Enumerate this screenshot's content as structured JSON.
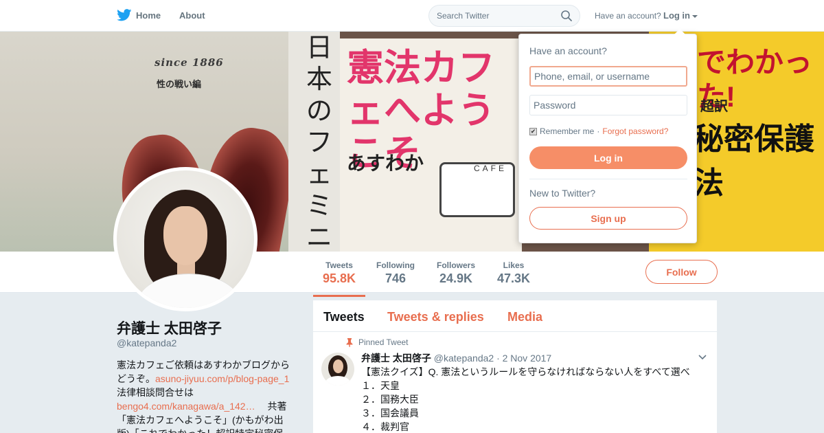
{
  "topnav": {
    "home_label": "Home",
    "about_label": "About",
    "search_placeholder": "Search Twitter",
    "have_account_text": "Have an account?",
    "login_label": "Log in",
    "brand_color": "#1da1f2"
  },
  "banner": {
    "left_book_since": "since 1886",
    "left_book_subtitle": "性の戦い編",
    "vertical_title": "日本のフェミニズ",
    "middle_title": "憲法カフェへようこそ",
    "middle_author": "あすわか",
    "cup_text": "CAFE",
    "right_title": "でわかった!",
    "right_sub": "超訳",
    "right_main": "秘密保護法"
  },
  "profile": {
    "name": "弁護士 太田啓子",
    "handle": "@katepanda2",
    "bio_text_1": "憲法カフェご依頼はあすわかブログからどうぞ。",
    "bio_link_1": "asuno-jiyuu.com/p/blog-page_1",
    "bio_text_2": " 　法律相談問合せは",
    "bio_link_2": "bengo4.com/kanagawa/a_142…",
    "bio_text_3": " 　共著「憲法カフェへようこそ」(かもがわ出版)「これでわかった！超訳特定秘密保"
  },
  "stats": [
    {
      "label": "Tweets",
      "value": "95.8K",
      "active": true
    },
    {
      "label": "Following",
      "value": "746"
    },
    {
      "label": "Followers",
      "value": "24.9K"
    },
    {
      "label": "Likes",
      "value": "47.3K"
    }
  ],
  "follow_button_label": "Follow",
  "timeline": {
    "tabs": [
      "Tweets",
      "Tweets & replies",
      "Media"
    ],
    "pinned_label": "Pinned Tweet",
    "tweet": {
      "name": "弁護士 太田啓子",
      "handle": "@katepanda2",
      "date": "· 2 Nov 2017",
      "lines": [
        "【憲法クイズ】Q. 憲法というルールを守らなければならない人をすべて選べ",
        "１．天皇",
        "２．国務大臣",
        "３．国会議員",
        "４．裁判官"
      ]
    }
  },
  "login_dropdown": {
    "title": "Have an account?",
    "username_placeholder": "Phone, email, or username",
    "password_placeholder": "Password",
    "remember_label": "Remember me",
    "separator": "·",
    "forgot_label": "Forgot password?",
    "login_button": "Log in",
    "new_to_twitter": "New to Twitter?",
    "signup_button": "Sign up",
    "accent_color": "#e86e4f"
  }
}
